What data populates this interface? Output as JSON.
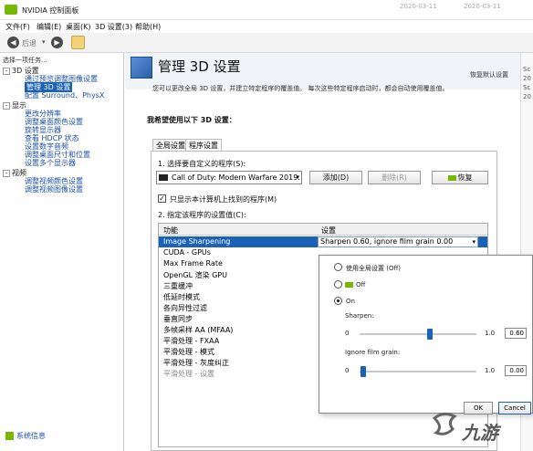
{
  "window": {
    "title": "NVIDIA 控制面板",
    "bg_timestamps": [
      "2020-03-11",
      "2020-03-11"
    ]
  },
  "menu": [
    "文件(F)",
    "编辑(E)",
    "桌面(K)",
    "3D 设置(3)",
    "帮助(H)"
  ],
  "toolbar": {
    "back_label": "后退"
  },
  "left": {
    "task_label": "选择一项任务...",
    "categories": [
      {
        "label": "3D 设置",
        "items": [
          "通过预览调整图像设置",
          "管理 3D 设置",
          "配置 Surround、PhysX"
        ]
      },
      {
        "label": "显示",
        "items": [
          "更改分辨率",
          "调整桌面颜色设置",
          "旋转显示器",
          "查看 HDCP 状态",
          "设置数字音频",
          "调整桌面尺寸和位置",
          "设置多个显示器"
        ]
      },
      {
        "label": "视频",
        "items": [
          "调整视频颜色设置",
          "调整视频图像设置"
        ]
      }
    ],
    "selected_item": "管理 3D 设置",
    "system_info": "系统信息"
  },
  "main": {
    "title": "管理 3D 设置",
    "restore": "恢复默认设置",
    "description": "您可以更改全局 3D 设置，并建立特定程序的覆盖值。 每次这些特定程序启动时，都会自动使用覆盖值。",
    "question": "我希望使用以下 3D 设置：",
    "tabs": [
      "全局设置",
      "程序设置"
    ],
    "active_tab": "程序设置",
    "step1": "1. 选择要自定义的程序(S):",
    "program": "Call of Duty: Modern Warfare 2019...",
    "add_button": "添加(D)",
    "remove_button": "删除(R)",
    "restore_button": "恢复",
    "only_show": "只显示本计算机上找到的程序(M)",
    "step2": "2. 指定该程序的设置值(C):",
    "table_headers": [
      "功能",
      "设置"
    ],
    "features": [
      "Image Sharpening",
      "CUDA - GPUs",
      "Max Frame Rate",
      "OpenGL 渲染 GPU",
      "三重缓冲",
      "低延时模式",
      "各向异性过滤",
      "垂直同步",
      "多帧采样 AA (MFAA)",
      "平滑处理 - FXAA",
      "平滑处理 - 模式",
      "平滑处理 - 灰度纠正",
      "平滑处理 - 设置"
    ],
    "selected_setting": "Sharpen 0.60, ignore film grain 0.00"
  },
  "popup": {
    "options": [
      "使用全局设置 (Off)",
      "Off",
      "On"
    ],
    "selected_option": "On",
    "sharpen": {
      "label": "Sharpen:",
      "min": "0",
      "max": "1.0",
      "value": "0.60",
      "fraction": 0.6
    },
    "grain": {
      "label": "Ignore film grain:",
      "min": "0",
      "max": "1.0",
      "value": "0.00",
      "fraction": 0.0
    },
    "ok": "OK",
    "cancel": "Cancel"
  },
  "right_clip": [
    "Sc",
    "20",
    "Sc",
    "20"
  ],
  "watermark": "九游"
}
